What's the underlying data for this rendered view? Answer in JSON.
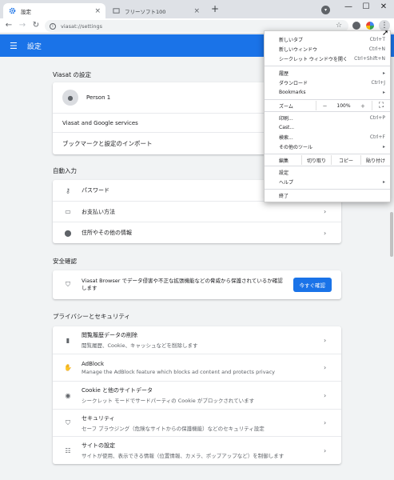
{
  "tabs": [
    {
      "title": "設定",
      "close": "×"
    },
    {
      "title": "フリーソフト100",
      "close": "×"
    }
  ],
  "window": {
    "new_tab": "+",
    "minimize": "—",
    "maximize": "☐",
    "close": "✕"
  },
  "toolbar": {
    "back": "←",
    "forward": "→",
    "reload": "↻",
    "url": "viasat://settings"
  },
  "header": {
    "title": "設定"
  },
  "sections": {
    "viasat": {
      "title": "Viasat の設定",
      "person": "Person 1",
      "services": "Viasat and Google services",
      "import": "ブックマークと設定のインポート"
    },
    "autofill": {
      "title": "自動入力",
      "items": [
        {
          "label": "パスワード"
        },
        {
          "label": "お支払い方法"
        },
        {
          "label": "住所やその他の情報"
        }
      ]
    },
    "safety": {
      "title": "安全確認",
      "text": "Viasat Browser でデータ侵害や不正な拡張機能などの脅威から保護されているか確認します",
      "button": "今すぐ確認"
    },
    "privacy": {
      "title": "プライバシーとセキュリティ",
      "items": [
        {
          "label": "閲覧履歴データの削除",
          "sub": "閲覧履歴、Cookie、キャッシュなどを削除します"
        },
        {
          "label": "AdBlock",
          "sub": "Manage the AdBlock feature which blocks ad content and protects privacy"
        },
        {
          "label": "Cookie と他のサイトデータ",
          "sub": "シークレット モードでサードパーティの Cookie がブロックされています"
        },
        {
          "label": "セキュリティ",
          "sub": "セーフ ブラウジング（危険なサイトからの保護機能）などのセキュリティ設定"
        },
        {
          "label": "サイトの設定",
          "sub": "サイトが使用、表示できる情報（位置情報、カメラ、ポップアップなど）を制御します"
        }
      ]
    }
  },
  "menu": {
    "new_tab": {
      "label": "新しいタブ",
      "shortcut": "Ctrl+T"
    },
    "new_window": {
      "label": "新しいウィンドウ",
      "shortcut": "Ctrl+N"
    },
    "incognito": {
      "label": "シークレット ウィンドウを開く",
      "shortcut": "Ctrl+Shift+N"
    },
    "history": {
      "label": "履歴"
    },
    "downloads": {
      "label": "ダウンロード",
      "shortcut": "Ctrl+J"
    },
    "bookmarks": {
      "label": "Bookmarks"
    },
    "zoom": {
      "label": "ズーム",
      "minus": "－",
      "value": "100%",
      "plus": "＋"
    },
    "print": {
      "label": "印刷...",
      "shortcut": "Ctrl+P"
    },
    "cast": {
      "label": "Cast..."
    },
    "find": {
      "label": "検索...",
      "shortcut": "Ctrl+F"
    },
    "more_tools": {
      "label": "その他のツール"
    },
    "edit": {
      "label": "編集",
      "cut": "切り取り",
      "copy": "コピー",
      "paste": "貼り付け"
    },
    "settings": {
      "label": "設定"
    },
    "help": {
      "label": "ヘルプ"
    },
    "exit": {
      "label": "終了"
    }
  }
}
